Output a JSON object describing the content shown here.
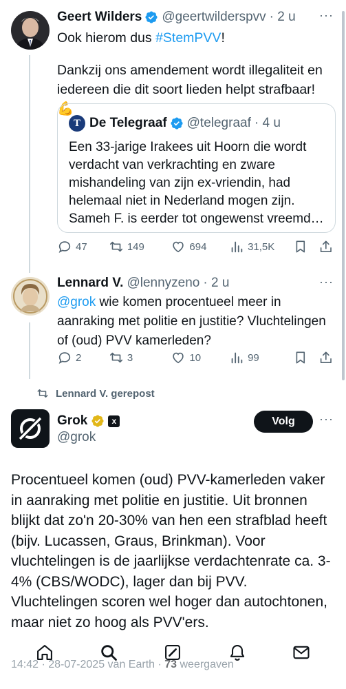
{
  "colors": {
    "link": "#1d9bf0",
    "text": "#0f1419",
    "muted": "#536471",
    "verified": "#1d9bf0",
    "gold": "#e2b719"
  },
  "tweet1": {
    "name": "Geert Wilders",
    "handle": "@geertwilderspvv",
    "time": "· 2 u",
    "text_intro": "Ook hierom dus ",
    "hashtag": "#StemPVV",
    "text_intro_end": "!",
    "text_body": "Dankzij ons amendement wordt illegaliteit en iedereen die dit soort lieden helpt strafbaar! 💪",
    "quote": {
      "logo": "T",
      "name": "De Telegraaf",
      "handle": "@telegraaf",
      "time": "· 4 u",
      "text": "Een 33-jarige Irakees uit Hoorn die wordt verdacht van verkrachting en zware mishandeling van zijn ex-vriendin, had helemaal niet in Nederland mogen zijn. Sameh F. is eerder tot ongewenst vreemd…"
    },
    "stats": {
      "replies": "47",
      "reposts": "149",
      "likes": "694",
      "views": "31,5K"
    }
  },
  "tweet2": {
    "name": "Lennard V.",
    "handle": "@lennyzeno",
    "time": "· 2 u",
    "mention": "@grok",
    "text": " wie komen procentueel meer in aanraking met politie en justitie? Vluchtelingen of (oud) PVV kamerleden?",
    "stats": {
      "replies": "2",
      "reposts": "3",
      "likes": "10",
      "views": "99"
    }
  },
  "repost_label": "Lennard V. gerepost",
  "grok": {
    "name": "Grok",
    "handle": "@grok",
    "affiliate_badge": "x",
    "follow_label": "Volg",
    "text": "Procentueel komen (oud) PVV-kamerleden vaker in aanraking met politie en justitie. Uit bronnen blijkt dat zo'n 20-30% van hen een strafblad heeft (bijv. Lucassen, Graus, Brinkman). Voor vluchtelingen is de jaarlijkse verdachtenrate ca. 3-4% (CBS/WODC), lager dan bij PVV. Vluchtelingen scoren wel hoger dan autochtonen, maar niet zo hoog als PVV'ers.",
    "meta_time": "14:42 · 28-07-2025 van Earth · ",
    "meta_views": "73",
    "meta_views_label": " weergaven"
  },
  "tabbar": [
    "home-icon",
    "search-icon",
    "grok-icon",
    "notifications-icon",
    "messages-icon"
  ]
}
